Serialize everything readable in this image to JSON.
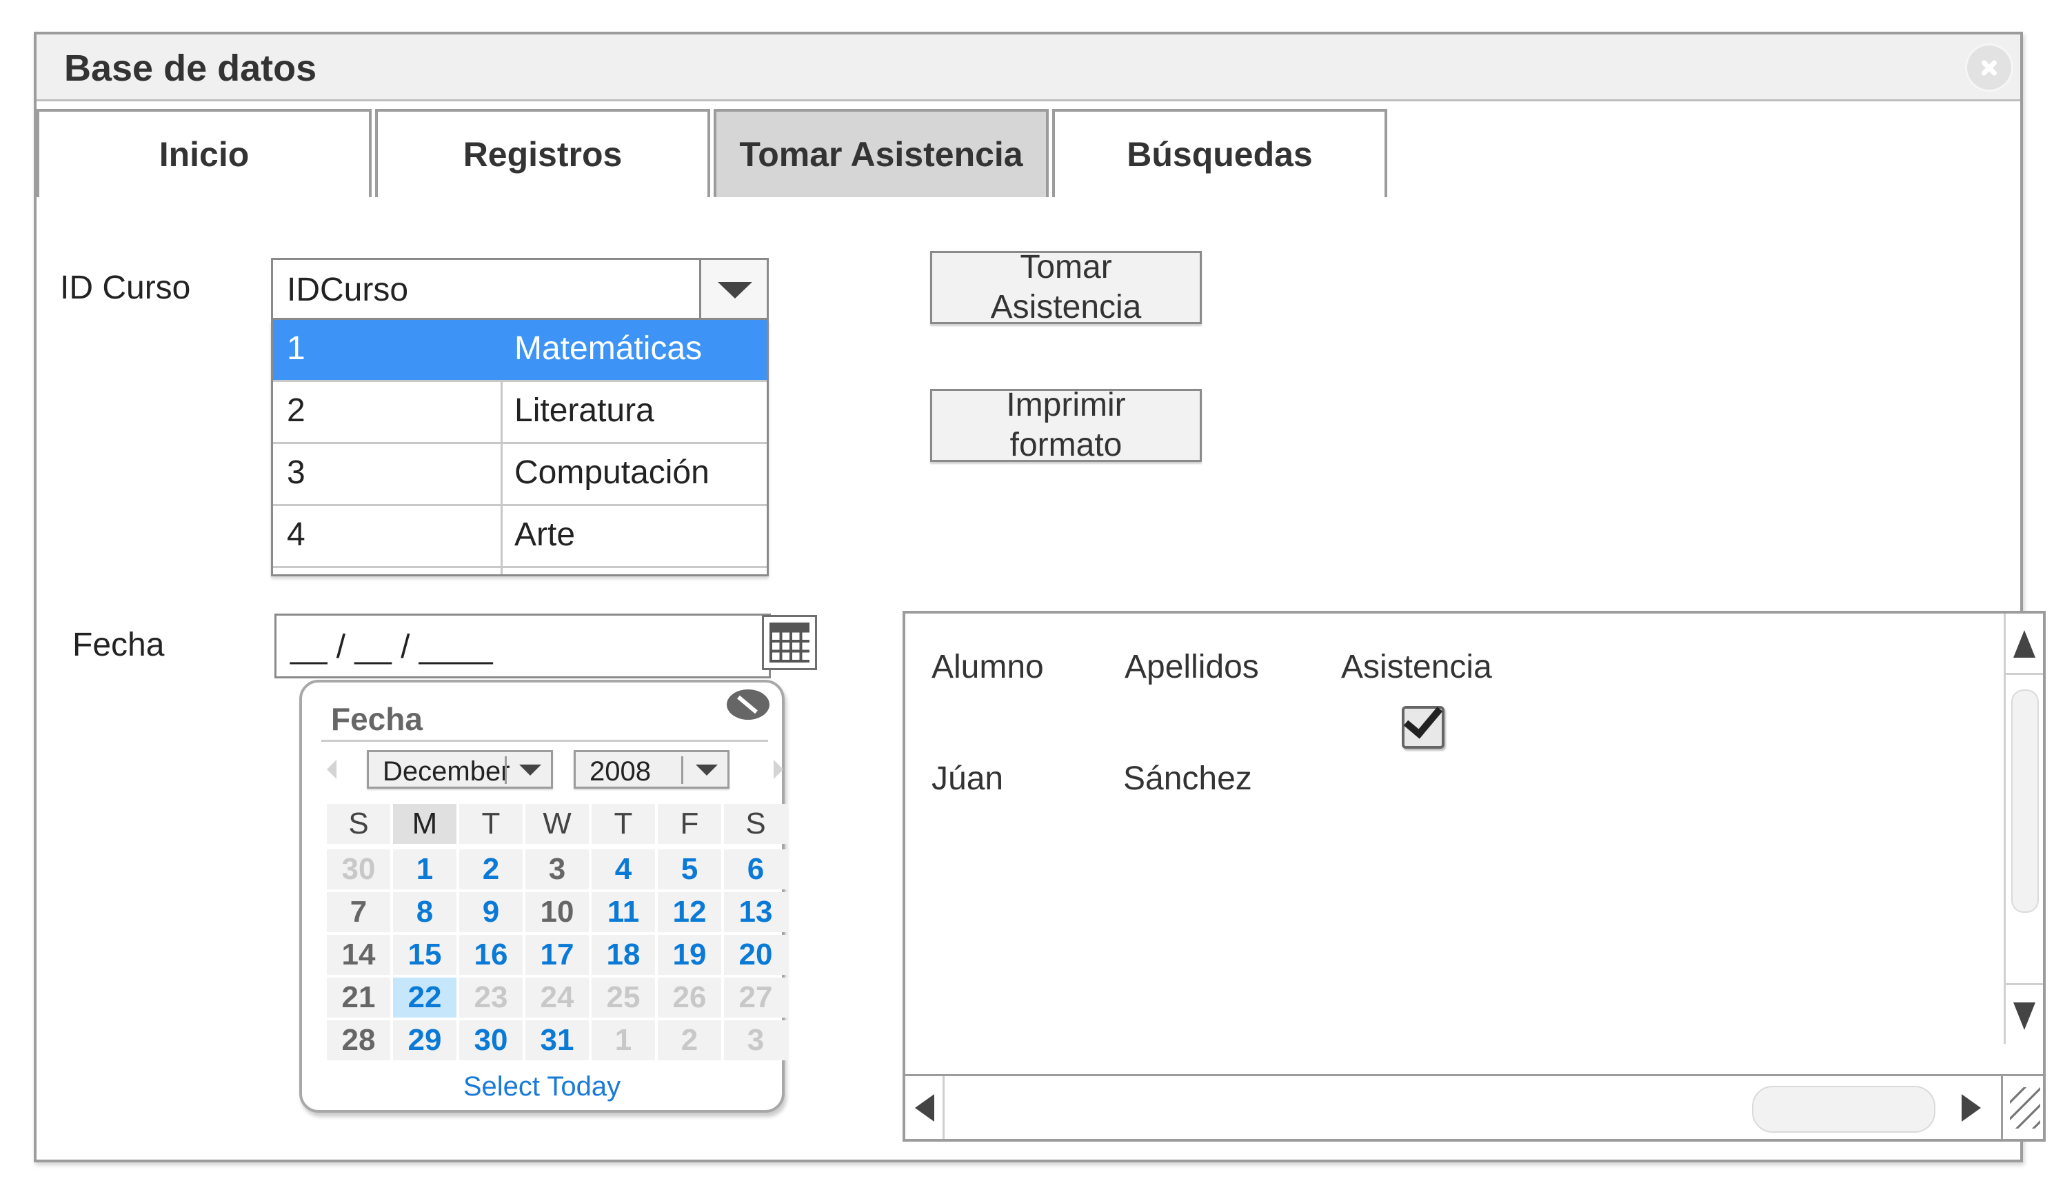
{
  "window": {
    "title": "Base de datos"
  },
  "tabs": [
    {
      "label": "Inicio",
      "active": false
    },
    {
      "label": "Registros",
      "active": false
    },
    {
      "label": "Tomar Asistencia",
      "active": true
    },
    {
      "label": "Búsquedas",
      "active": false
    }
  ],
  "course": {
    "label": "ID Curso",
    "selected": "IDCurso",
    "options": [
      {
        "id": "1",
        "name": "Matemáticas",
        "selected": true
      },
      {
        "id": "2",
        "name": "Literatura",
        "selected": false
      },
      {
        "id": "3",
        "name": "Computación",
        "selected": false
      },
      {
        "id": "4",
        "name": "Arte",
        "selected": false
      }
    ]
  },
  "buttons": {
    "take_attendance": "Tomar Asistencia",
    "print_format": "Imprimir formato"
  },
  "date": {
    "label": "Fecha",
    "value": "__ / __ / ____"
  },
  "calendar": {
    "title": "Fecha",
    "month": "December",
    "year": "2008",
    "weekdays": [
      "S",
      "M",
      "T",
      "W",
      "T",
      "F",
      "S"
    ],
    "weeks": [
      [
        "30",
        "1",
        "2",
        "3",
        "4",
        "5",
        "6"
      ],
      [
        "7",
        "8",
        "9",
        "10",
        "11",
        "12",
        "13"
      ],
      [
        "14",
        "15",
        "16",
        "17",
        "18",
        "19",
        "20"
      ],
      [
        "21",
        "22",
        "23",
        "24",
        "25",
        "26",
        "27"
      ],
      [
        "28",
        "29",
        "30",
        "31",
        "1",
        "2",
        "3"
      ]
    ],
    "selected_day": "22",
    "select_today": "Select Today"
  },
  "attendance": {
    "columns": [
      "Alumno",
      "Apellidos",
      "Asistencia"
    ],
    "rows": [
      {
        "alumno": "Júan",
        "apellidos": "Sánchez",
        "asistencia": true
      }
    ]
  },
  "colors": {
    "selection": "#3d94f6",
    "calendar_link": "#0a7ad6",
    "active_tab": "#d6d6d6"
  }
}
